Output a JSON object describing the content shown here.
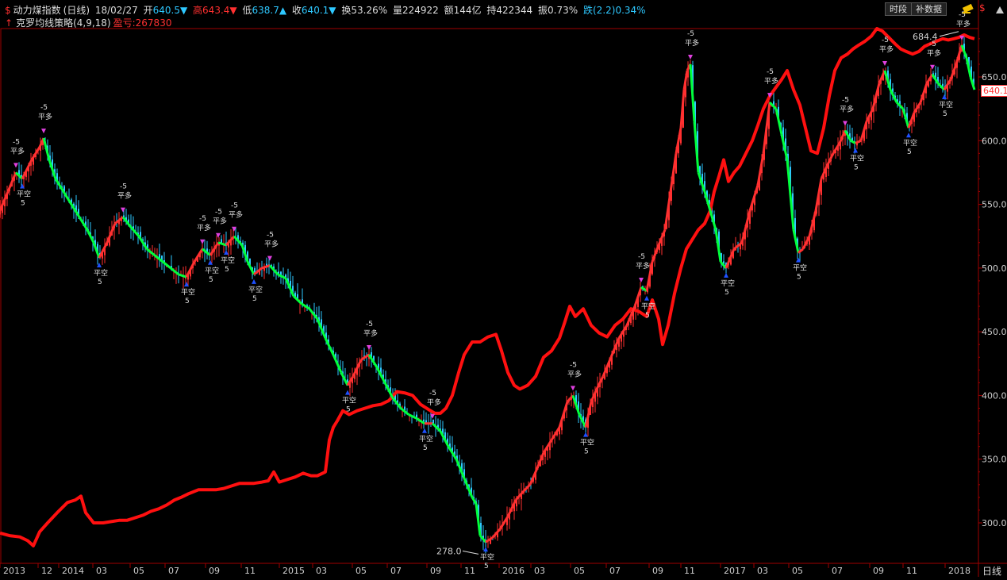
{
  "header": {
    "icon": "$",
    "title": "动力煤指数",
    "period": "(日线)",
    "date": "18/02/27",
    "open_label": "开",
    "open": "640.5",
    "high_label": "高",
    "high": "643.4",
    "low_label": "低",
    "low": "638.7",
    "close_label": "收",
    "close": "640.1",
    "turnover_label": "换",
    "turnover": "53.26%",
    "volume_label": "量",
    "volume": "224922",
    "amount_label": "额",
    "amount": "144亿",
    "oi_label": "持",
    "oi": "422344",
    "amplitude_label": "振",
    "amplitude": "0.73%",
    "change_label": "跌",
    "change": "(2.2)0.34%",
    "strategy_name": "克罗均线策略(4,9,18)",
    "profit_label": "盈亏:",
    "profit": "267830"
  },
  "toolbar": {
    "btn_time": "时段",
    "btn_supplement": "补数据",
    "cur_price": "640.1",
    "annot_high": "684.4",
    "annot_low": "278.0",
    "axis_unit": "日线"
  },
  "colors": {
    "background": "#000000",
    "up": "#ff3030",
    "down": "#00ff3c",
    "candle_up": "#ff3030",
    "candle_down": "#2ec8ff",
    "equity": "#ff1010",
    "axis": "#a00000"
  },
  "chart_data": {
    "type": "line",
    "title": "动力煤指数",
    "y_ticks": [
      300.0,
      350.0,
      400.0,
      450.0,
      500.0,
      550.0,
      600.0,
      650.0
    ],
    "ylim": [
      273,
      693
    ],
    "x_ticks": [
      "2013",
      "12",
      "2014",
      "03",
      "05",
      "07",
      "09",
      "11",
      "2015",
      "03",
      "05",
      "07",
      "09",
      "11",
      "2016",
      "03",
      "05",
      "07",
      "09",
      "11",
      "2017",
      "03",
      "05",
      "07",
      "09",
      "11",
      "2018"
    ],
    "series": [
      {
        "name": "动力煤指数",
        "points": [
          [
            0,
            545
          ],
          [
            10,
            560
          ],
          [
            20,
            575
          ],
          [
            28,
            570
          ],
          [
            40,
            585
          ],
          [
            50,
            595
          ],
          [
            55,
            602
          ],
          [
            62,
            585
          ],
          [
            70,
            570
          ],
          [
            80,
            560
          ],
          [
            90,
            550
          ],
          [
            100,
            540
          ],
          [
            110,
            530
          ],
          [
            118,
            520
          ],
          [
            125,
            508
          ],
          [
            135,
            520
          ],
          [
            145,
            535
          ],
          [
            155,
            540
          ],
          [
            165,
            532
          ],
          [
            175,
            525
          ],
          [
            185,
            515
          ],
          [
            195,
            510
          ],
          [
            205,
            505
          ],
          [
            215,
            500
          ],
          [
            225,
            495
          ],
          [
            235,
            493
          ],
          [
            245,
            505
          ],
          [
            255,
            515
          ],
          [
            265,
            510
          ],
          [
            275,
            520
          ],
          [
            285,
            518
          ],
          [
            295,
            525
          ],
          [
            305,
            518
          ],
          [
            312,
            505
          ],
          [
            320,
            495
          ],
          [
            330,
            500
          ],
          [
            340,
            502
          ],
          [
            350,
            495
          ],
          [
            360,
            492
          ],
          [
            370,
            478
          ],
          [
            380,
            472
          ],
          [
            390,
            468
          ],
          [
            400,
            460
          ],
          [
            410,
            445
          ],
          [
            420,
            432
          ],
          [
            430,
            418
          ],
          [
            438,
            408
          ],
          [
            445,
            415
          ],
          [
            455,
            428
          ],
          [
            465,
            432
          ],
          [
            475,
            422
          ],
          [
            485,
            410
          ],
          [
            495,
            398
          ],
          [
            505,
            390
          ],
          [
            515,
            385
          ],
          [
            525,
            382
          ],
          [
            535,
            378
          ],
          [
            545,
            378
          ],
          [
            555,
            372
          ],
          [
            565,
            360
          ],
          [
            575,
            350
          ],
          [
            585,
            335
          ],
          [
            595,
            320
          ],
          [
            600,
            315
          ],
          [
            605,
            290
          ],
          [
            612,
            285
          ],
          [
            620,
            288
          ],
          [
            630,
            295
          ],
          [
            640,
            305
          ],
          [
            650,
            318
          ],
          [
            660,
            325
          ],
          [
            668,
            330
          ],
          [
            675,
            340
          ],
          [
            685,
            355
          ],
          [
            695,
            365
          ],
          [
            705,
            375
          ],
          [
            715,
            395
          ],
          [
            722,
            400
          ],
          [
            730,
            385
          ],
          [
            738,
            375
          ],
          [
            745,
            395
          ],
          [
            752,
            405
          ],
          [
            760,
            415
          ],
          [
            770,
            430
          ],
          [
            780,
            445
          ],
          [
            790,
            455
          ],
          [
            800,
            470
          ],
          [
            808,
            485
          ],
          [
            815,
            482
          ],
          [
            822,
            505
          ],
          [
            830,
            518
          ],
          [
            838,
            530
          ],
          [
            845,
            560
          ],
          [
            852,
            590
          ],
          [
            858,
            610
          ],
          [
            862,
            640
          ],
          [
            866,
            655
          ],
          [
            870,
            660
          ],
          [
            875,
            615
          ],
          [
            880,
            575
          ],
          [
            888,
            560
          ],
          [
            895,
            545
          ],
          [
            902,
            530
          ],
          [
            908,
            505
          ],
          [
            915,
            500
          ],
          [
            925,
            515
          ],
          [
            935,
            520
          ],
          [
            945,
            545
          ],
          [
            955,
            565
          ],
          [
            962,
            590
          ],
          [
            970,
            630
          ],
          [
            978,
            625
          ],
          [
            985,
            605
          ],
          [
            992,
            585
          ],
          [
            1000,
            530
          ],
          [
            1006,
            512
          ],
          [
            1012,
            515
          ],
          [
            1020,
            525
          ],
          [
            1028,
            545
          ],
          [
            1035,
            570
          ],
          [
            1042,
            580
          ],
          [
            1050,
            590
          ],
          [
            1058,
            598
          ],
          [
            1065,
            608
          ],
          [
            1072,
            600
          ],
          [
            1078,
            598
          ],
          [
            1085,
            600
          ],
          [
            1092,
            615
          ],
          [
            1100,
            625
          ],
          [
            1108,
            645
          ],
          [
            1115,
            655
          ],
          [
            1122,
            640
          ],
          [
            1130,
            630
          ],
          [
            1138,
            625
          ],
          [
            1145,
            610
          ],
          [
            1152,
            622
          ],
          [
            1160,
            630
          ],
          [
            1168,
            645
          ],
          [
            1175,
            652
          ],
          [
            1182,
            645
          ],
          [
            1190,
            640
          ],
          [
            1198,
            648
          ],
          [
            1205,
            660
          ],
          [
            1212,
            675
          ],
          [
            1218,
            665
          ],
          [
            1223,
            650
          ],
          [
            1228,
            640
          ]
        ]
      },
      {
        "name": "克罗均线策略 盈亏",
        "points": [
          [
            0,
            292
          ],
          [
            12,
            290
          ],
          [
            25,
            289
          ],
          [
            35,
            286
          ],
          [
            42,
            282
          ],
          [
            50,
            293
          ],
          [
            60,
            300
          ],
          [
            72,
            308
          ],
          [
            85,
            316
          ],
          [
            95,
            318
          ],
          [
            102,
            321
          ],
          [
            108,
            308
          ],
          [
            118,
            300
          ],
          [
            130,
            300
          ],
          [
            140,
            301
          ],
          [
            150,
            302
          ],
          [
            160,
            302
          ],
          [
            170,
            304
          ],
          [
            180,
            306
          ],
          [
            190,
            309
          ],
          [
            200,
            311
          ],
          [
            210,
            314
          ],
          [
            220,
            318
          ],
          [
            228,
            320
          ],
          [
            238,
            323
          ],
          [
            250,
            326
          ],
          [
            260,
            326
          ],
          [
            272,
            326
          ],
          [
            282,
            327
          ],
          [
            292,
            329
          ],
          [
            302,
            331
          ],
          [
            312,
            331
          ],
          [
            320,
            331
          ],
          [
            330,
            332
          ],
          [
            338,
            333
          ],
          [
            345,
            340
          ],
          [
            352,
            332
          ],
          [
            362,
            334
          ],
          [
            372,
            336
          ],
          [
            382,
            339
          ],
          [
            392,
            337
          ],
          [
            400,
            337
          ],
          [
            410,
            340
          ],
          [
            415,
            365
          ],
          [
            420,
            375
          ],
          [
            425,
            380
          ],
          [
            432,
            388
          ],
          [
            440,
            385
          ],
          [
            450,
            388
          ],
          [
            460,
            390
          ],
          [
            470,
            392
          ],
          [
            480,
            393
          ],
          [
            490,
            396
          ],
          [
            500,
            403
          ],
          [
            510,
            402
          ],
          [
            520,
            400
          ],
          [
            530,
            393
          ],
          [
            540,
            389
          ],
          [
            548,
            386
          ],
          [
            555,
            386
          ],
          [
            562,
            390
          ],
          [
            570,
            400
          ],
          [
            578,
            418
          ],
          [
            585,
            432
          ],
          [
            595,
            442
          ],
          [
            605,
            442
          ],
          [
            615,
            446
          ],
          [
            625,
            448
          ],
          [
            632,
            435
          ],
          [
            640,
            418
          ],
          [
            648,
            408
          ],
          [
            655,
            405
          ],
          [
            665,
            408
          ],
          [
            675,
            415
          ],
          [
            685,
            430
          ],
          [
            695,
            435
          ],
          [
            705,
            445
          ],
          [
            712,
            458
          ],
          [
            718,
            470
          ],
          [
            725,
            462
          ],
          [
            735,
            468
          ],
          [
            745,
            455
          ],
          [
            755,
            449
          ],
          [
            765,
            446
          ],
          [
            775,
            455
          ],
          [
            785,
            460
          ],
          [
            795,
            468
          ],
          [
            805,
            466
          ],
          [
            815,
            462
          ],
          [
            822,
            475
          ],
          [
            830,
            460
          ],
          [
            835,
            440
          ],
          [
            842,
            455
          ],
          [
            850,
            480
          ],
          [
            858,
            500
          ],
          [
            865,
            515
          ],
          [
            872,
            522
          ],
          [
            880,
            530
          ],
          [
            888,
            535
          ],
          [
            895,
            545
          ],
          [
            900,
            560
          ],
          [
            906,
            572
          ],
          [
            912,
            585
          ],
          [
            918,
            568
          ],
          [
            925,
            575
          ],
          [
            932,
            580
          ],
          [
            940,
            590
          ],
          [
            948,
            600
          ],
          [
            955,
            612
          ],
          [
            962,
            625
          ],
          [
            970,
            635
          ],
          [
            978,
            642
          ],
          [
            985,
            648
          ],
          [
            992,
            655
          ],
          [
            1000,
            640
          ],
          [
            1008,
            628
          ],
          [
            1015,
            610
          ],
          [
            1022,
            592
          ],
          [
            1030,
            590
          ],
          [
            1038,
            610
          ],
          [
            1045,
            635
          ],
          [
            1052,
            655
          ],
          [
            1060,
            665
          ],
          [
            1068,
            668
          ],
          [
            1075,
            672
          ],
          [
            1082,
            675
          ],
          [
            1090,
            678
          ],
          [
            1098,
            682
          ],
          [
            1105,
            688
          ],
          [
            1112,
            686
          ],
          [
            1120,
            681
          ],
          [
            1128,
            676
          ],
          [
            1135,
            672
          ],
          [
            1142,
            670
          ],
          [
            1150,
            668
          ],
          [
            1158,
            670
          ],
          [
            1165,
            674
          ],
          [
            1172,
            676
          ],
          [
            1180,
            678
          ],
          [
            1188,
            680
          ],
          [
            1195,
            679
          ],
          [
            1202,
            680
          ],
          [
            1208,
            681
          ],
          [
            1215,
            683
          ],
          [
            1222,
            681
          ],
          [
            1228,
            680
          ]
        ]
      }
    ]
  }
}
